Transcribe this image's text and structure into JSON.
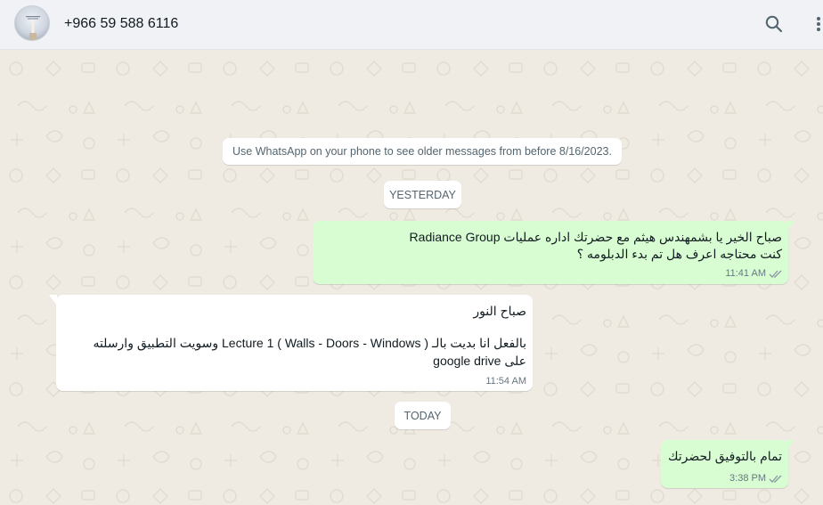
{
  "header": {
    "contact_name": "+966 59 588 6116",
    "avatar_icon": "profile-photo",
    "search_icon": "search-icon",
    "menu_icon": "more-vertical-icon"
  },
  "chat": {
    "system_notice": "Use WhatsApp on your phone to see older messages from before 8/16/2023.",
    "day_separators": [
      "YESTERDAY",
      "TODAY"
    ],
    "messages": [
      {
        "direction": "outgoing",
        "lines": [
          "صباح الخير يا بشمهندس هيثم مع حضرتك اداره عمليات Radiance Group",
          "كنت محتاجه اعرف هل تم بدء الدبلومه ؟"
        ],
        "time": "11:41 AM",
        "status": "read"
      },
      {
        "direction": "incoming",
        "lines": [
          "صباح النور",
          "",
          "بالفعل انا بديت بالـ ( Lecture 1 ( Walls - Doors - Windows وسويت التطبيق وارسلته",
          "على google drive"
        ],
        "time": "11:54 AM"
      },
      {
        "direction": "outgoing",
        "lines": [
          "تمام بالتوفيق لحضرتك"
        ],
        "time": "3:38 PM",
        "status": "read"
      }
    ]
  },
  "colors": {
    "chat_background": "#efeae2",
    "header_background": "#f0f2f5",
    "outgoing_bubble": "#d9fdd3",
    "incoming_bubble": "#ffffff",
    "read_ticks": "#8696a0"
  }
}
